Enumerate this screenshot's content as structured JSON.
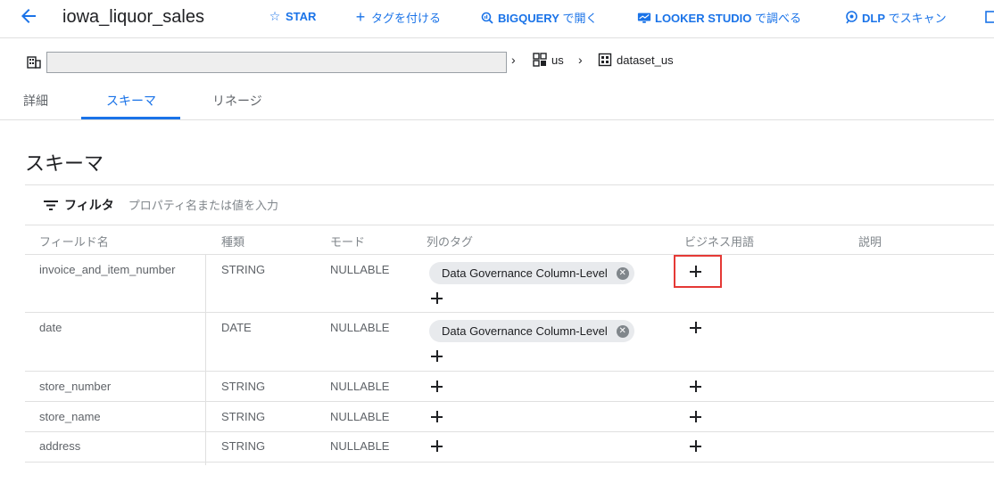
{
  "header": {
    "title": "iowa_liquor_sales",
    "back_icon": "arrow-left-icon",
    "actions": [
      {
        "icon": "star-outline-icon",
        "label": "STAR"
      },
      {
        "icon": "plus-icon",
        "label": "タグを付ける"
      },
      {
        "icon": "bigquery-icon",
        "label_bold": "BIGQUERY",
        "label": " で開く"
      },
      {
        "icon": "looker-studio-icon",
        "label_bold": "LOOKER STUDIO",
        "label": " で調べる"
      },
      {
        "icon": "dlp-icon",
        "label_bold": "DLP",
        "label": " でスキャン"
      }
    ]
  },
  "breadcrumb": {
    "project_icon": "building-icon",
    "items": [
      {
        "icon": "location-grid-icon",
        "label": "us"
      },
      {
        "icon": "dataset-icon",
        "label": "dataset_us"
      }
    ]
  },
  "tabs": [
    {
      "label": "詳細",
      "active": false
    },
    {
      "label": "スキーマ",
      "active": true
    },
    {
      "label": "リネージ",
      "active": false
    }
  ],
  "schema": {
    "title": "スキーマ",
    "filter": {
      "icon": "filter-icon",
      "label": "フィルタ",
      "placeholder": "プロパティ名または値を入力"
    },
    "columns": [
      "フィールド名",
      "種類",
      "モード",
      "列のタグ",
      "ビジネス用語",
      "説明"
    ],
    "rows": [
      {
        "name": "invoice_and_item_number",
        "type": "STRING",
        "mode": "NULLABLE",
        "tag": "Data Governance Column-Level"
      },
      {
        "name": "date",
        "type": "DATE",
        "mode": "NULLABLE",
        "tag": "Data Governance Column-Level"
      },
      {
        "name": "store_number",
        "type": "STRING",
        "mode": "NULLABLE",
        "tag": ""
      },
      {
        "name": "store_name",
        "type": "STRING",
        "mode": "NULLABLE",
        "tag": ""
      },
      {
        "name": "address",
        "type": "STRING",
        "mode": "NULLABLE",
        "tag": ""
      }
    ]
  },
  "colors": {
    "accent": "#1a73e8",
    "highlight": "#e53935",
    "chip": "#e8eaed"
  }
}
